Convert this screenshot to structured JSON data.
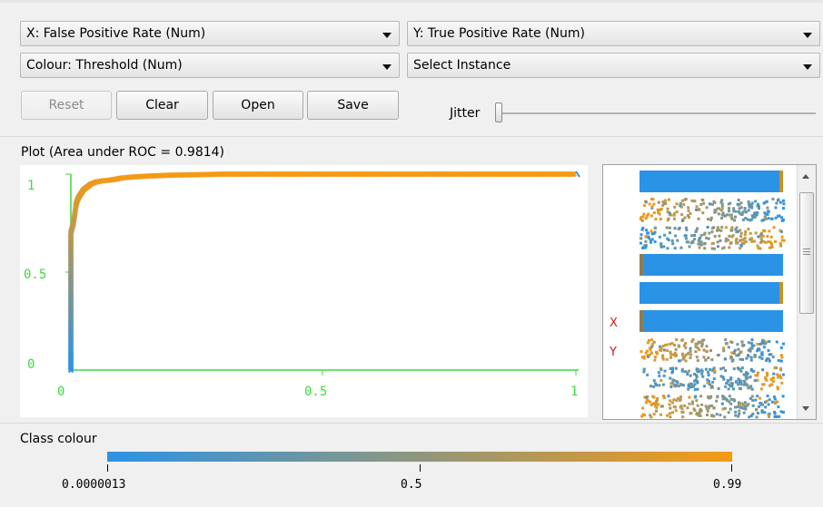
{
  "controls": {
    "x_axis": "X: False Positive Rate (Num)",
    "y_axis": "Y: True Positive Rate (Num)",
    "colour": "Colour: Threshold (Num)",
    "instance": "Select Instance"
  },
  "buttons": {
    "reset": "Reset",
    "clear": "Clear",
    "open": "Open",
    "save": "Save"
  },
  "jitter": {
    "label": "Jitter",
    "value": 0
  },
  "plot": {
    "title": "Plot (Area under ROC = 0.9814)"
  },
  "attribute_panel": {
    "x_marker": "X",
    "y_marker": "Y"
  },
  "class_colour": {
    "title": "Class colour",
    "ticks": [
      "0.0000013",
      "0.5",
      "0.99"
    ],
    "colors": [
      "#2b93e6",
      "#f59a13"
    ]
  },
  "chart_data": {
    "type": "scatter",
    "xlim": [
      0,
      1
    ],
    "ylim": [
      0,
      1
    ],
    "x_ticks": [
      "0",
      "0.5",
      "1"
    ],
    "y_ticks": [
      "0",
      "0.5",
      "1"
    ],
    "series": [
      {
        "x": [
          0,
          0,
          0,
          0,
          0.005,
          0.008,
          0.01,
          0.012,
          0.015,
          0.02,
          0.025,
          0.03,
          0.04,
          0.05,
          0.06,
          0.08,
          0.1,
          0.12,
          0.15,
          0.2,
          0.25,
          0.3,
          0.4,
          0.5,
          0.6,
          0.8,
          1.0
        ],
        "y": [
          0,
          0.2,
          0.5,
          0.7,
          0.75,
          0.8,
          0.84,
          0.86,
          0.88,
          0.9,
          0.92,
          0.93,
          0.95,
          0.96,
          0.965,
          0.97,
          0.98,
          0.985,
          0.99,
          0.995,
          0.997,
          1,
          1,
          1,
          1,
          1,
          1
        ]
      }
    ]
  }
}
